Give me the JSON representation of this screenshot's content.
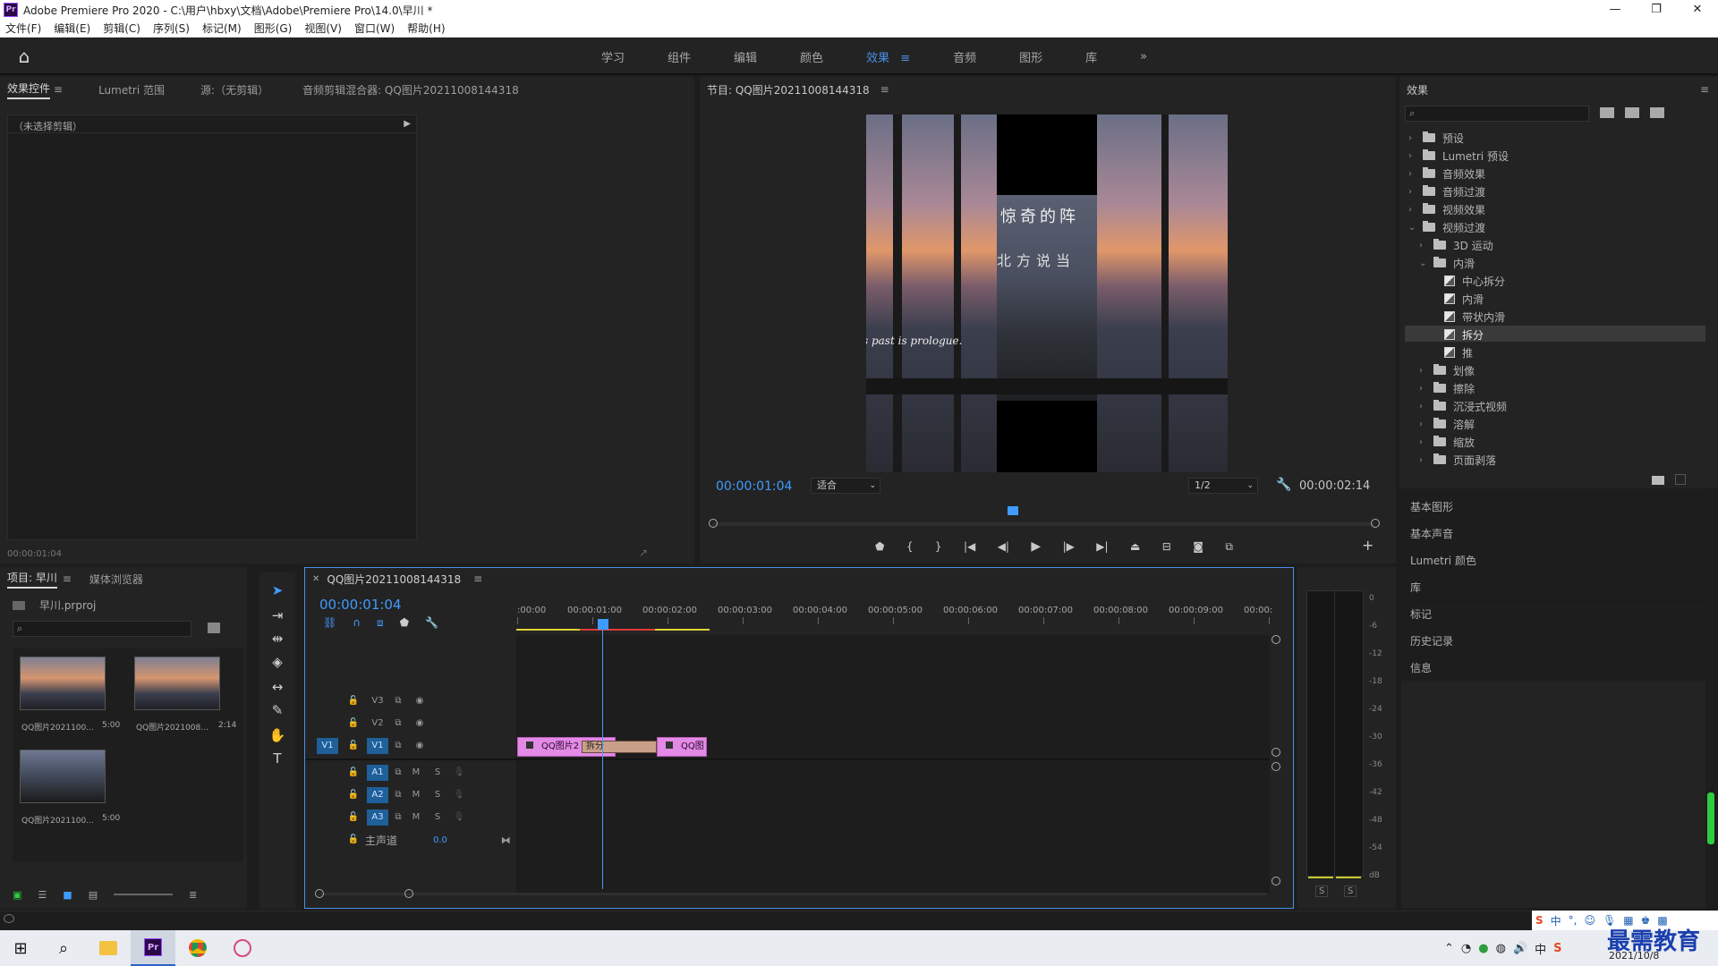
{
  "titlebar": {
    "logo": "Pr",
    "title": "Adobe Premiere Pro 2020 - C:\\用户\\hbxy\\文档\\Adobe\\Premiere Pro\\14.0\\早川 *",
    "minimize": "—",
    "maximize": "❐",
    "close": "✕"
  },
  "menu": [
    "文件(F)",
    "编辑(E)",
    "剪辑(C)",
    "序列(S)",
    "标记(M)",
    "图形(G)",
    "视图(V)",
    "窗口(W)",
    "帮助(H)"
  ],
  "workspaces": [
    "学习",
    "组件",
    "编辑",
    "颜色",
    "效果",
    "音频",
    "图形",
    "库"
  ],
  "workspace_menu": "≡",
  "workspace_more": "»",
  "source_panel": {
    "tabs": [
      "效果控件",
      "Lumetri 范围",
      "源:（无剪辑）",
      "音频剪辑混合器: QQ图片20211008144318"
    ],
    "no_clip": "（未选择剪辑）",
    "timecode": "00:00:01:04"
  },
  "program_panel": {
    "title": "节目: QQ图片20211008144318",
    "timecode": "00:00:01:04",
    "fit": "适合",
    "resolution": "1/2",
    "duration": "00:00:02:14",
    "overlay_line1": "惊奇的阵",
    "overlay_line2": "北方说当",
    "overlay_line3": "s past is prologue."
  },
  "project_panel": {
    "tabs": [
      "项目: 早川",
      "媒体浏览器"
    ],
    "file": "早川.prproj",
    "items": [
      {
        "name": "QQ图片2021100...",
        "dur": "5:00"
      },
      {
        "name": "QQ图片2021008...",
        "dur": "2:14"
      },
      {
        "name": "QQ图片2021100...",
        "dur": "5:00"
      }
    ]
  },
  "timeline": {
    "title": "QQ图片20211008144318",
    "timecode": "00:00:01:04",
    "ruler": [
      ":00:00",
      "00:00:01:00",
      "00:00:02:00",
      "00:00:03:00",
      "00:00:04:00",
      "00:00:05:00",
      "00:00:06:00",
      "00:00:07:00",
      "00:00:08:00",
      "00:00:09:00",
      "00:00:"
    ],
    "video_tracks": [
      "V3",
      "V2",
      "V1"
    ],
    "audio_tracks": [
      "A1",
      "A2",
      "A3"
    ],
    "source_patch": "V1",
    "mute": "M",
    "solo": "S",
    "master": "主声道",
    "master_val": "0.0",
    "clip1": "QQ图片2",
    "clip2": "QQ图",
    "transition": "拆分"
  },
  "meter": {
    "labels": [
      "0",
      "-6",
      "-12",
      "-18",
      "-24",
      "-30",
      "-36",
      "-42",
      "-48",
      "-54",
      "dB"
    ],
    "solo_left": "S",
    "solo_right": "S"
  },
  "effects_panel": {
    "title": "效果",
    "tree": [
      {
        "label": "预设",
        "level": 0,
        "type": "folder",
        "open": false
      },
      {
        "label": "Lumetri 预设",
        "level": 0,
        "type": "folder",
        "open": false
      },
      {
        "label": "音频效果",
        "level": 0,
        "type": "folder",
        "open": false
      },
      {
        "label": "音频过渡",
        "level": 0,
        "type": "folder",
        "open": false
      },
      {
        "label": "视频效果",
        "level": 0,
        "type": "folder",
        "open": false
      },
      {
        "label": "视频过渡",
        "level": 0,
        "type": "folder",
        "open": true
      },
      {
        "label": "3D 运动",
        "level": 1,
        "type": "folder",
        "open": false
      },
      {
        "label": "内滑",
        "level": 1,
        "type": "folder",
        "open": true
      },
      {
        "label": "中心拆分",
        "level": 2,
        "type": "fx"
      },
      {
        "label": "内滑",
        "level": 2,
        "type": "fx"
      },
      {
        "label": "带状内滑",
        "level": 2,
        "type": "fx"
      },
      {
        "label": "拆分",
        "level": 2,
        "type": "fx",
        "selected": true
      },
      {
        "label": "推",
        "level": 2,
        "type": "fx"
      },
      {
        "label": "划像",
        "level": 1,
        "type": "folder",
        "open": false
      },
      {
        "label": "擦除",
        "level": 1,
        "type": "folder",
        "open": false
      },
      {
        "label": "沉浸式视频",
        "level": 1,
        "type": "folder",
        "open": false
      },
      {
        "label": "溶解",
        "level": 1,
        "type": "folder",
        "open": false
      },
      {
        "label": "缩放",
        "level": 1,
        "type": "folder",
        "open": false
      },
      {
        "label": "页面剥落",
        "level": 1,
        "type": "folder",
        "open": false
      }
    ],
    "sections": [
      "基本图形",
      "基本声音",
      "Lumetri 颜色",
      "库",
      "标记",
      "历史记录",
      "信息"
    ]
  },
  "taskbar": {
    "date": "2021/10/8",
    "watermark": "最需教育",
    "ime": "中"
  }
}
